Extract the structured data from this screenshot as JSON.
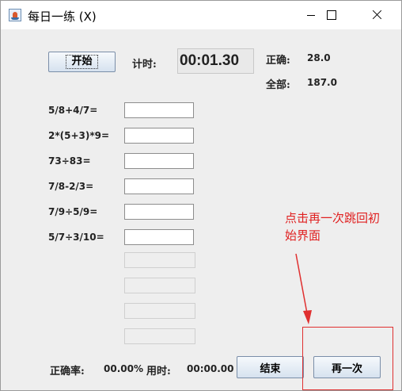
{
  "window": {
    "title": "每日一练 (X)"
  },
  "header": {
    "start_label": "开始",
    "timer_label": "计时:",
    "timer_value": "00:01.30",
    "correct_label": "正确:",
    "correct_value": "28.0",
    "total_label": "全部:",
    "total_value": "187.0"
  },
  "questions": [
    {
      "text": "5/8+4/7=",
      "answer": ""
    },
    {
      "text": "2*(5+3)*9=",
      "answer": ""
    },
    {
      "text": "73÷83=",
      "answer": ""
    },
    {
      "text": "7/8-2/3=",
      "answer": ""
    },
    {
      "text": "7/9÷5/9=",
      "answer": ""
    },
    {
      "text": "5/7÷3/10=",
      "answer": ""
    }
  ],
  "footer": {
    "accuracy_label": "正确率:",
    "accuracy_value": "00.00%",
    "time_label": "用时:",
    "time_value": "00:00.00",
    "end_label": "结束",
    "again_label": "再一次"
  },
  "annotation": {
    "line1": "点击再一次跳回初",
    "line2": "始界面",
    "color": "#e02020"
  }
}
